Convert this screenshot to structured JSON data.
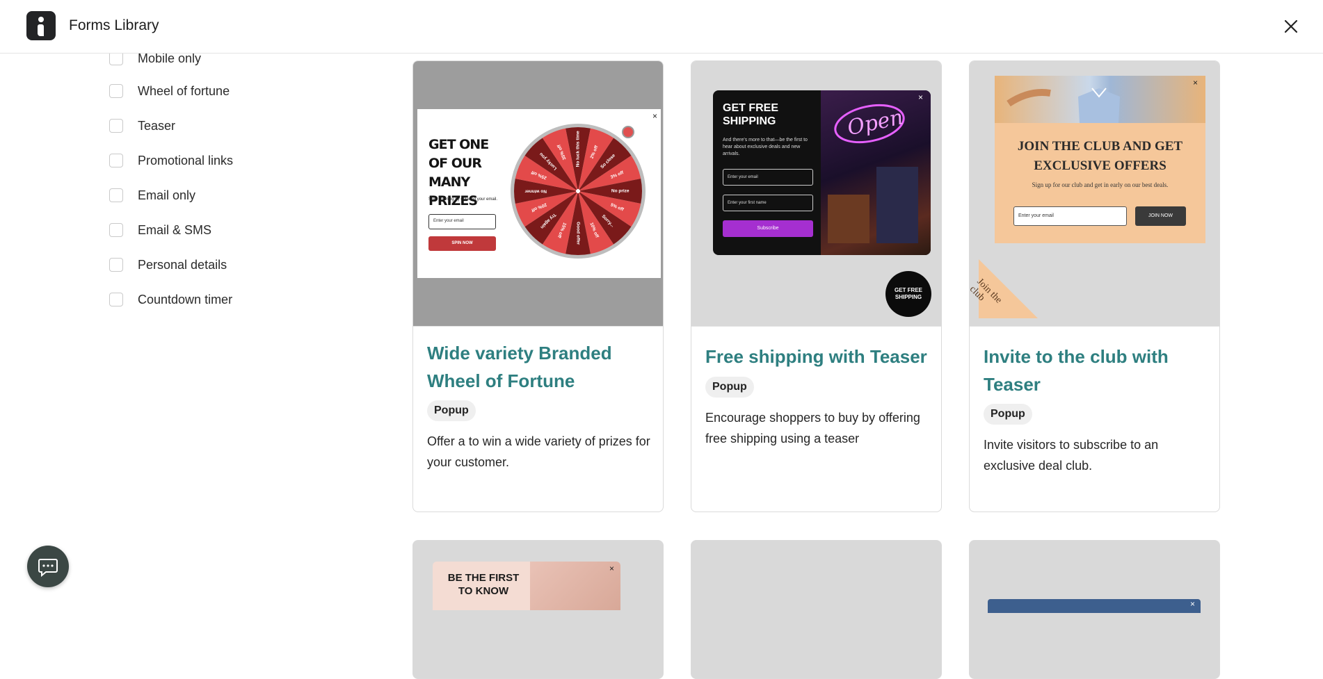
{
  "header": {
    "title": "Forms Library"
  },
  "filters": [
    "Mobile only",
    "Wheel of fortune",
    "Teaser",
    "Promotional links",
    "Email only",
    "Email & SMS",
    "Personal details",
    "Countdown timer"
  ],
  "cards": [
    {
      "title": "Wide variety Branded Wheel of Fortune",
      "badge": "Popup",
      "description": "Offer a to win a wide variety of prizes for your customer.",
      "preview": {
        "heading": "GET ONE OF OUR MANY PRIZES",
        "sub": "Start spinning by entering your email.",
        "input_placeholder": "Enter your email",
        "button": "SPIN NOW",
        "close": "×",
        "slices": [
          "No luck this time",
          "2% off",
          "So close",
          "3% off",
          "No prize",
          "5% off",
          "Sorry...",
          "10% off",
          "Good offer",
          "15% off",
          "Try again",
          "20% off",
          "No winner",
          "25% off",
          "Lucky you",
          "35% off"
        ]
      }
    },
    {
      "title": "Free shipping with Teaser",
      "badge": "Popup",
      "description": "Encourage shoppers to buy by offering free shipping using a teaser",
      "preview": {
        "heading": "GET FREE SHIPPING",
        "sub": "And there's more to that—be the first to hear about exclusive deals and new arrivals.",
        "email_placeholder": "Enter your email",
        "name_placeholder": "Enter your first name",
        "button": "Subscribe",
        "neon": "Open",
        "teaser": "GET FREE SHIPPING",
        "close": "×"
      }
    },
    {
      "title": "Invite to the club with Teaser",
      "badge": "Popup",
      "description": "Invite visitors to subscribe to an exclusive deal club.",
      "preview": {
        "heading": "JOIN THE CLUB AND GET EXCLUSIVE OFFERS",
        "sub": "Sign up for our club and get in early on our best deals.",
        "input_placeholder": "Enter your email",
        "button": "JOIN NOW",
        "teaser": "Join the club",
        "close": "×"
      }
    },
    {
      "preview": {
        "heading": "BE THE FIRST TO KNOW",
        "close": "×"
      }
    },
    {
      "preview": {}
    },
    {
      "preview": {
        "close": "×"
      }
    }
  ],
  "colors": {
    "accent": "#2e7f80",
    "wheel_red": "#e34a4a",
    "wheel_dark": "#7a1a1a",
    "spin_button": "#c0393b",
    "subscribe_button": "#a52fd0",
    "club_bg": "#f5c79a"
  }
}
